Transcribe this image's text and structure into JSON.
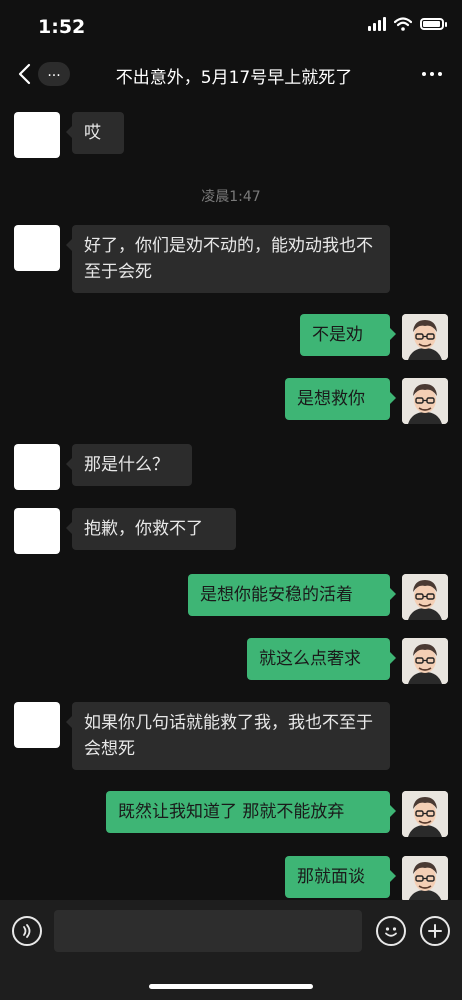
{
  "status": {
    "time": "1:52"
  },
  "nav": {
    "more_label": "...",
    "title": "不出意外，5月17号早上就死了"
  },
  "timestamp": "凌晨1:47",
  "messages": [
    {
      "from": "them",
      "text": "哎"
    },
    {
      "from": "them",
      "text": "好了，你们是劝不动的，能劝动我也不至于会死"
    },
    {
      "from": "me",
      "text": "不是劝"
    },
    {
      "from": "me",
      "text": "是想救你"
    },
    {
      "from": "them",
      "text": "那是什么？"
    },
    {
      "from": "them",
      "text": "抱歉，你救不了"
    },
    {
      "from": "me",
      "text": "是想你能安稳的活着"
    },
    {
      "from": "me",
      "text": "就这么点奢求"
    },
    {
      "from": "them",
      "text": "如果你几句话就能救了我，我也不至于会想死"
    },
    {
      "from": "me",
      "text": "既然让我知道了 那就不能放弃"
    },
    {
      "from": "me",
      "text": "那就面谈"
    }
  ],
  "icons": {
    "back": "chevron-left-icon",
    "menu": "more-horizontal-icon",
    "voice": "voice-icon",
    "emoji": "emoji-icon",
    "plus": "plus-icon"
  },
  "colors": {
    "background": "#111111",
    "bubble_them": "#2c2c2c",
    "bubble_me": "#3eb575"
  }
}
